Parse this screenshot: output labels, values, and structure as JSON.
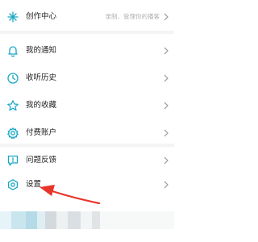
{
  "menu": {
    "create_center": {
      "label": "创作中心",
      "hint": "录制、管理你的播客",
      "icon": "sparkle-icon"
    },
    "notifications": {
      "label": "我的通知",
      "icon": "bell-icon"
    },
    "history": {
      "label": "收听历史",
      "icon": "clock-icon"
    },
    "favorites": {
      "label": "我的收藏",
      "icon": "star-icon"
    },
    "paid_account": {
      "label": "付费账户",
      "icon": "gear-icon"
    },
    "feedback": {
      "label": "问题反馈",
      "icon": "feedback-icon"
    },
    "settings": {
      "label": "设置",
      "icon": "hexagon-icon"
    }
  },
  "colors": {
    "accent": "#1aa7c7",
    "arrow": "#e8352b",
    "text": "#222222",
    "hint": "#b2b2b2",
    "separator": "#f4f4f4"
  }
}
